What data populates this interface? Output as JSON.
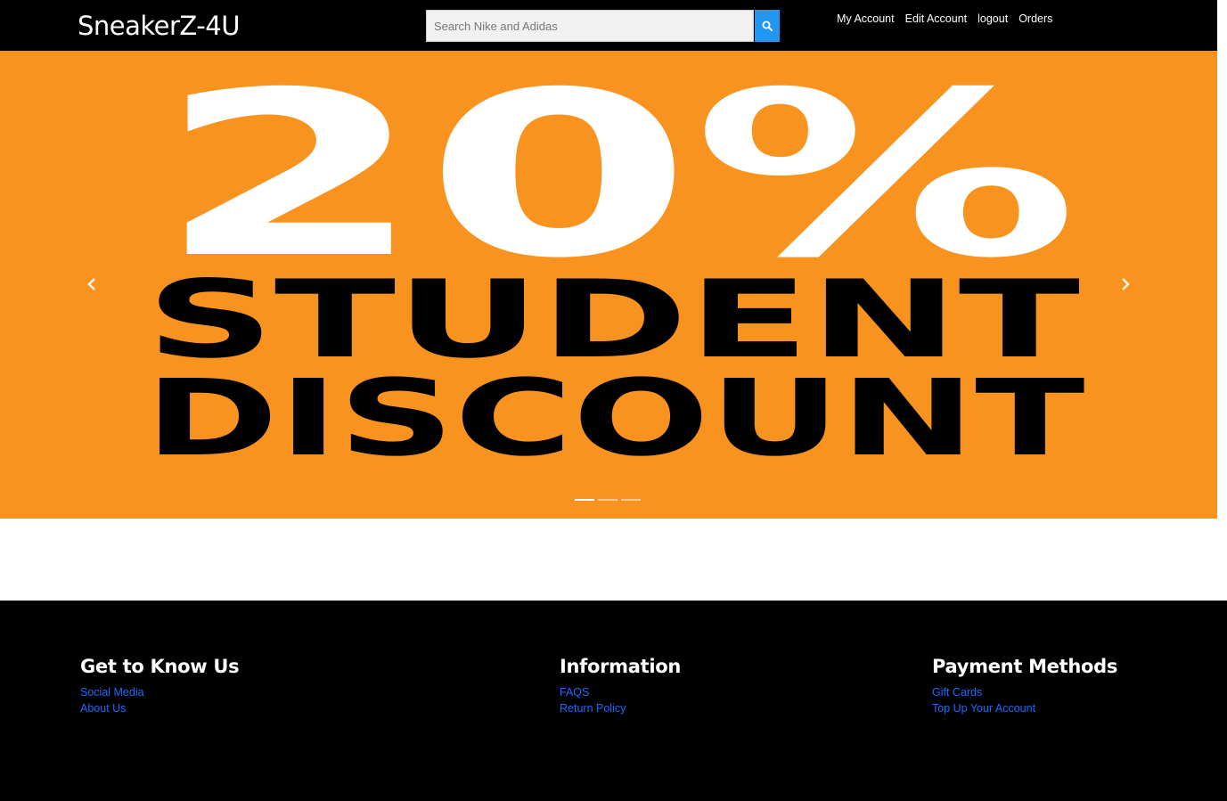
{
  "header": {
    "brand": "SneakerZ-4U",
    "search": {
      "placeholder": "Search Nike and Adidas",
      "value": ""
    },
    "nav": [
      {
        "label": "My Account"
      },
      {
        "label": "Edit Account"
      },
      {
        "label": "logout"
      },
      {
        "label": "Orders"
      }
    ]
  },
  "carousel": {
    "banner": {
      "percent": "20%",
      "line1": "STUDENT",
      "line2": "DISCOUNT"
    },
    "background_color": "#f7931e",
    "slide_count": 3,
    "active_slide": 1
  },
  "footer": {
    "columns": [
      {
        "heading": "Get to Know Us",
        "links": [
          "Social Media",
          "About Us"
        ]
      },
      {
        "heading": "Information",
        "links": [
          "FAQS",
          "Return Policy"
        ]
      },
      {
        "heading": "Payment Methods",
        "links": [
          "Gift Cards",
          "Top Up Your Account"
        ]
      }
    ]
  },
  "colors": {
    "accent": "#2196f3",
    "link": "#1a6bff",
    "navbar": "#000000"
  }
}
